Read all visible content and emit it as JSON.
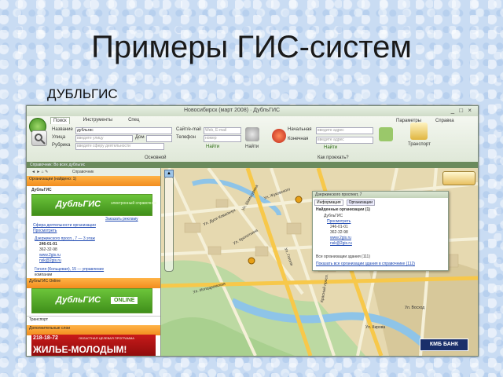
{
  "slide": {
    "title": "Примеры ГИС-систем",
    "subtitle": "ДУБЛЬГИС"
  },
  "window": {
    "title": "Новосибирск (март 2008) · ДубльГИС",
    "controls": "_ □ ×"
  },
  "toolbar": {
    "tabs": [
      "Поиск",
      "Инструменты",
      "Спец"
    ],
    "active_tab": "Поиск",
    "search_fields": {
      "name_label": "Название",
      "name_value": "дубльгис",
      "street_label": "Улица",
      "street_placeholder": "введите улицу",
      "rubric_label": "Рубрика",
      "rubric_placeholder": "введите сферу деятельности",
      "house_label": "Дом",
      "site_label": "Сайт/e-mail",
      "site_placeholder": "Web, E-mail",
      "phone_label": "Телефон",
      "phone_placeholder": "номер",
      "find_button": "Найти",
      "start_label": "Начальная",
      "start_placeholder": "введите адрес",
      "end_label": "Конечная",
      "end_placeholder": "введите адрес",
      "route_find": "Найти",
      "transport_label": "Транспорт"
    },
    "section_main": "Основной",
    "section_route": "Как проехать?",
    "settings": "Параметры",
    "help": "Справка"
  },
  "status": "Справочник: Во всех дубльгис",
  "sidebar": {
    "nav_label": "Справочник",
    "org_header": "Организации (найдено: 1)",
    "org_name": "ДубльГИС",
    "logo_text": "ДубльГИС",
    "logo_tagline": "электронный справочник",
    "ad_link": "Заказать рекламу",
    "spec_links": [
      "Сфера деятельности организации",
      "Просмотреть"
    ],
    "address": "Дзержинского просп., 7 — 3 этаж",
    "phones": [
      "246-01-01",
      "362-32-98"
    ],
    "sites": [
      "www.2gis.ru",
      "nsk@2gis.ru"
    ],
    "second_address": "Гоголя (Кольцевая), 15 — управление",
    "second_sub": "компании",
    "online_header": "ДубльГИС Online",
    "online_text": "ONLINE",
    "transport_header": "Транспорт",
    "extra_header": "Дополнительные слои",
    "banner_phone": "218-18-72",
    "banner_program": "ОБЛАСТНАЯ ЦЕЛЕВАЯ ПРОГРАММА",
    "banner_text": "ЖИЛЬЕ-МОЛОДЫМ!"
  },
  "map": {
    "streets": [
      "Ул. Дуси Ковальчук",
      "Ул. Шамшурина",
      "Ул. Жуковского",
      "Ул. Кропоткина",
      "Ул. Гоголя",
      "Ул. Ипподромская",
      "Красный просп.",
      "Ул. Кирова",
      "Ул. Восход"
    ],
    "popup": {
      "title": "Дзержинского проспект, 7",
      "tabs": [
        "Информация",
        "Организации"
      ],
      "found_label": "Найденные организации (1)",
      "org_name": "ДубльГИС",
      "org_link": "Просмотреть",
      "phones": [
        "246-01-01",
        "362-32-98"
      ],
      "sites": [
        "www.2gis.ru",
        "nsk@2gis.ru"
      ],
      "all_label": "Все организации здания (111)",
      "all_link": "Показать все организации здания в справочнике (112)"
    },
    "bank_logo": "КМБ БАНК"
  },
  "colors": {
    "accent_green": "#3f8f1a",
    "orange_header": "#f28c1e",
    "banner_red": "#c81a1a",
    "bank_blue": "#1a2f6a"
  }
}
